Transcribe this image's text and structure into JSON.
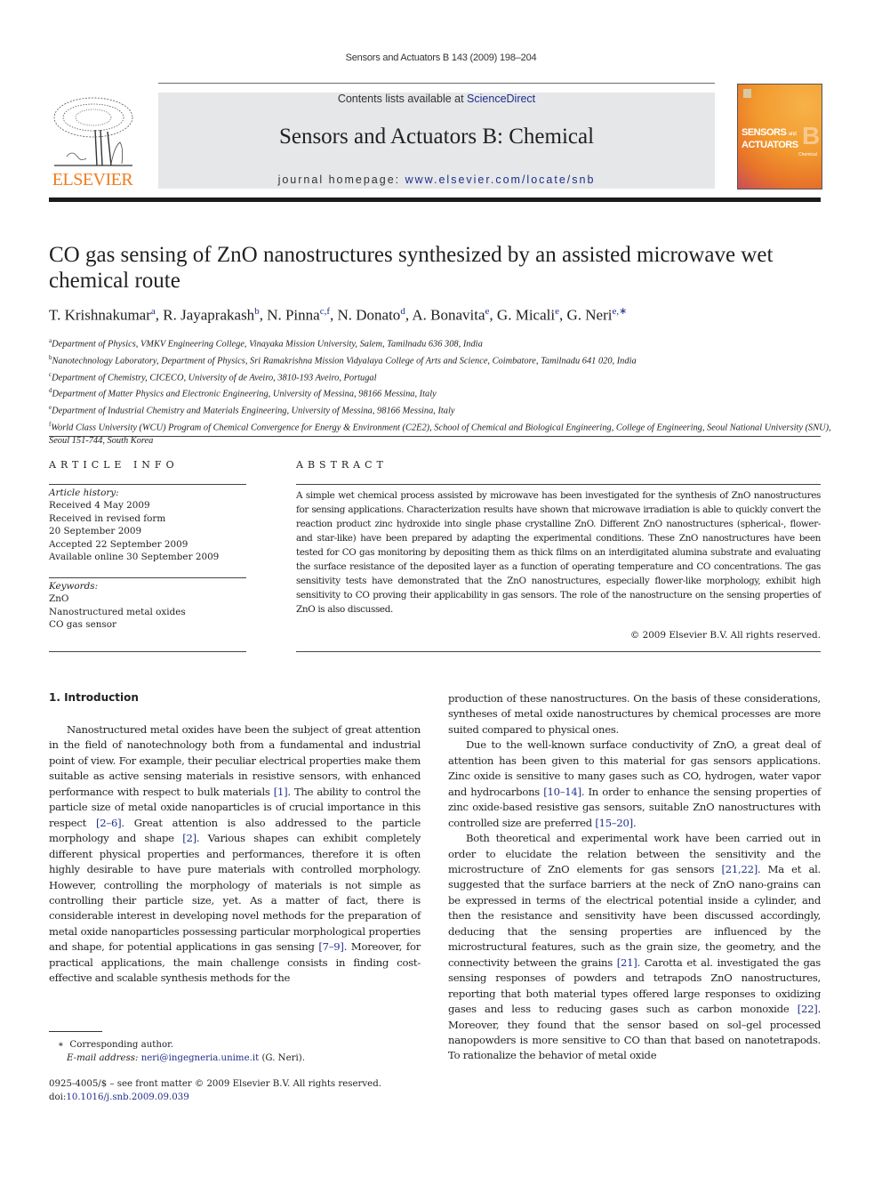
{
  "running_head": "Sensors and Actuators B 143 (2009) 198–204",
  "publisher_logo": {
    "word": "ELSEVIER",
    "icon": "elsevier-tree-icon",
    "color": "#f07c1e"
  },
  "banner": {
    "contents_prefix": "Contents lists available at ",
    "contents_link": "ScienceDirect",
    "journal_title": "Sensors and Actuators B: Chemical",
    "homepage_prefix": "journal homepage: ",
    "homepage_link": "www.elsevier.com/locate/snb",
    "background": "#e6e7e9"
  },
  "cover": {
    "line1": "SENSORS",
    "line1_small": "and",
    "line2": "ACTUATORS",
    "letter": "B",
    "sub": "Chemical"
  },
  "article": {
    "title": "CO gas sensing of ZnO nanostructures synthesized by an assisted microwave wet chemical route",
    "authors": [
      {
        "name": "T. Krishnakumar",
        "sup": "a",
        "sep": ", "
      },
      {
        "name": "R. Jayaprakash",
        "sup": "b",
        "sep": ", "
      },
      {
        "name": "N. Pinna",
        "sup": "c,f",
        "sep": ", "
      },
      {
        "name": "N. Donato",
        "sup": "d",
        "sep": ", "
      },
      {
        "name": "A. Bonavita",
        "sup": "e",
        "sep": ", "
      },
      {
        "name": "G. Micali",
        "sup": "e",
        "sep": ", "
      },
      {
        "name": "G. Neri",
        "sup": "e,∗",
        "sep": ""
      }
    ],
    "affiliations": [
      {
        "key": "a",
        "text": "Department of Physics, VMKV Engineering College, Vinayaka Mission University, Salem, Tamilnadu 636 308, India"
      },
      {
        "key": "b",
        "text": "Nanotechnology Laboratory, Department of Physics, Sri Ramakrishna Mission Vidyalaya College of Arts and Science, Coimbatore, Tamilnadu 641 020, India"
      },
      {
        "key": "c",
        "text": "Department of Chemistry, CICECO, University of de Aveiro, 3810-193 Aveiro, Portugal"
      },
      {
        "key": "d",
        "text": "Department of Matter Physics and Electronic Engineering, University of Messina, 98166 Messina, Italy"
      },
      {
        "key": "e",
        "text": "Department of Industrial Chemistry and Materials Engineering, University of Messina, 98166 Messina, Italy"
      },
      {
        "key": "f",
        "text": "World Class University (WCU) Program of Chemical Convergence for Energy & Environment (C2E2), School of Chemical and Biological Engineering, College of Engineering, Seoul National University (SNU), Seoul 151-744, South Korea"
      }
    ]
  },
  "article_info": {
    "heading": "ARTICLE INFO",
    "history_label": "Article history:",
    "history": [
      "Received 4 May 2009",
      "Received in revised form",
      "20 September 2009",
      "Accepted 22 September 2009",
      "Available online 30 September 2009"
    ],
    "keywords_label": "Keywords:",
    "keywords": [
      "ZnO",
      "Nanostructured metal oxides",
      "CO gas sensor"
    ]
  },
  "abstract": {
    "heading": "ABSTRACT",
    "text": "A simple wet chemical process assisted by microwave has been investigated for the synthesis of ZnO nanostructures for sensing applications. Characterization results have shown that microwave irradiation is able to quickly convert the reaction product zinc hydroxide into single phase crystalline ZnO. Different ZnO nanostructures (spherical-, flower- and star-like) have been prepared by adapting the experimental conditions. These ZnO nanostructures have been tested for CO gas monitoring by depositing them as thick films on an interdigitated alumina substrate and evaluating the surface resistance of the deposited layer as a function of operating temperature and CO concentrations. The gas sensitivity tests have demonstrated that the ZnO nanostructures, especially flower-like morphology, exhibit high sensitivity to CO proving their applicability in gas sensors. The role of the nanostructure on the sensing properties of ZnO is also discussed.",
    "copyright": "© 2009 Elsevier B.V. All rights reserved."
  },
  "body": {
    "section_heading": "1.  Introduction",
    "left_paragraph": [
      {
        "t": "Nanostructured metal oxides have been the subject of great attention in the field of nanotechnology both from a fundamental and industrial point of view. For example, their peculiar electrical properties make them suitable as active sensing materials in resistive sensors, with enhanced performance with respect to bulk materials "
      },
      {
        "ref": "[1]"
      },
      {
        "t": ". The ability to control the particle size of metal oxide nanoparticles is of crucial importance in this respect "
      },
      {
        "ref": "[2–6]"
      },
      {
        "t": ". Great attention is also addressed to the particle morphology and shape "
      },
      {
        "ref": "[2]"
      },
      {
        "t": ". Various shapes can exhibit completely different physical properties and performances, therefore it is often highly desirable to have pure materials with controlled morphology. However, controlling the morphology of materials is not simple as controlling their particle size, yet. As a matter of fact, there is considerable interest in developing novel methods for the preparation of metal oxide nanoparticles possessing particular morphological properties and shape, for potential applications in gas sensing "
      },
      {
        "ref": "[7–9]"
      },
      {
        "t": ". Moreover, for practical applications, the main challenge consists in finding cost-effective and scalable synthesis methods for the"
      }
    ],
    "right_paragraphs": [
      {
        "indent": false,
        "runs": [
          {
            "t": "production of these nanostructures. On the basis of these considerations, syntheses of metal oxide nanostructures by chemical processes are more suited compared to physical ones."
          }
        ]
      },
      {
        "indent": true,
        "runs": [
          {
            "t": "Due to the well-known surface conductivity of ZnO, a great deal of attention has been given to this material for gas sensors applications. Zinc oxide is sensitive to many gases such as CO, hydrogen, water vapor and hydrocarbons "
          },
          {
            "ref": "[10–14]"
          },
          {
            "t": ". In order to enhance the sensing properties of zinc oxide-based resistive gas sensors, suitable ZnO nanostructures with controlled size are preferred "
          },
          {
            "ref": "[15–20]"
          },
          {
            "t": "."
          }
        ]
      },
      {
        "indent": true,
        "runs": [
          {
            "t": "Both theoretical and experimental work have been carried out in order to elucidate the relation between the sensitivity and the microstructure of ZnO elements for gas sensors "
          },
          {
            "ref": "[21,22]"
          },
          {
            "t": ". Ma et al. suggested that the surface barriers at the neck of ZnO nano-grains can be expressed in terms of the electrical potential inside a cylinder, and then the resistance and sensitivity have been discussed accordingly, deducing that the sensing properties are influenced by the microstructural features, such as the grain size, the geometry, and the connectivity between the grains "
          },
          {
            "ref": "[21]"
          },
          {
            "t": ". Carotta et al. investigated the gas sensing responses of powders and tetrapods ZnO nanostructures, reporting that both material types offered large responses to oxidizing gases and less to reducing gases such as carbon monoxide "
          },
          {
            "ref": "[22]"
          },
          {
            "t": ". Moreover, they found that the sensor based on sol–gel processed nanopowders is more sensitive to CO than that based on nanotetrapods. To rationalize the behavior of metal oxide"
          }
        ]
      }
    ]
  },
  "footnote": {
    "marker": "∗",
    "corresponding": "Corresponding author.",
    "email_label": "E-mail address:",
    "email": "neri@ingegneria.unime.it",
    "email_suffix": " (G. Neri)."
  },
  "legal": {
    "issn_line": "0925-4005/$ – see front matter © 2009 Elsevier B.V. All rights reserved.",
    "doi_prefix": "doi:",
    "doi": "10.1016/j.snb.2009.09.039"
  },
  "colors": {
    "link": "#1f2f8a",
    "elsevier_orange": "#f07c1e",
    "rule": "#1b1b1b"
  }
}
